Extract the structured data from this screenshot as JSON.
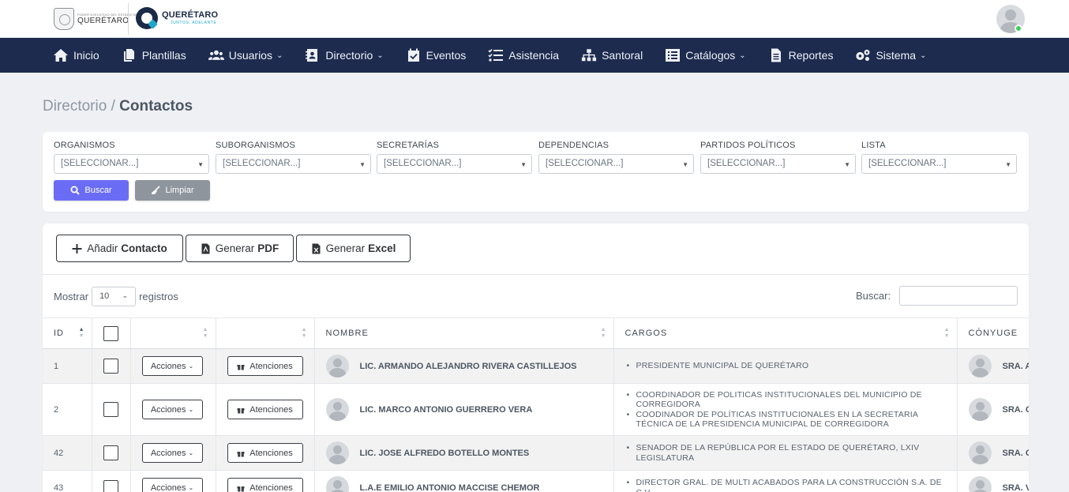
{
  "header": {
    "logo1_small": "PODER EJECUTIVO DEL ESTADO DE",
    "logo1_big": "QUERÉTARO",
    "logo2_title": "QUERÉTARO",
    "logo2_tag": "JUNTOS, ADELANTE"
  },
  "nav": [
    {
      "label": "Inicio",
      "icon": "home-icon",
      "dropdown": false
    },
    {
      "label": "Plantillas",
      "icon": "copy-icon",
      "dropdown": false
    },
    {
      "label": "Usuarios",
      "icon": "users-icon",
      "dropdown": true
    },
    {
      "label": "Directorio",
      "icon": "address-book-icon",
      "dropdown": true
    },
    {
      "label": "Eventos",
      "icon": "calendar-check-icon",
      "dropdown": false
    },
    {
      "label": "Asistencia",
      "icon": "checklist-icon",
      "dropdown": false
    },
    {
      "label": "Santoral",
      "icon": "sitemap-icon",
      "dropdown": false
    },
    {
      "label": "Catálogos",
      "icon": "list-alt-icon",
      "dropdown": true
    },
    {
      "label": "Reportes",
      "icon": "file-text-icon",
      "dropdown": false
    },
    {
      "label": "Sistema",
      "icon": "gears-icon",
      "dropdown": true
    }
  ],
  "breadcrumb": {
    "parent": "Directorio",
    "separator": " / ",
    "current": "Contactos"
  },
  "filters": [
    {
      "label": "ORGANISMOS",
      "value": "[SELECCIONAR...]"
    },
    {
      "label": "SUBORGANISMOS",
      "value": "[SELECCIONAR...]"
    },
    {
      "label": "SECRETARÍAS",
      "value": "[SELECCIONAR...]"
    },
    {
      "label": "DEPENDENCIAS",
      "value": "[SELECCIONAR...]"
    },
    {
      "label": "PARTIDOS POLÍTICOS",
      "value": "[SELECCIONAR...]"
    },
    {
      "label": "LISTA",
      "value": "[SELECCIONAR...]"
    }
  ],
  "filter_buttons": {
    "search": "Buscar",
    "clear": "Limpiar",
    "search_color": "#6a6cf5",
    "clear_color": "#8e959d"
  },
  "toolbar": {
    "add_prefix": "Añadir",
    "add_bold": "Contacto",
    "pdf_prefix": "Generar",
    "pdf_bold": "PDF",
    "excel_prefix": "Generar",
    "excel_bold": "Excel"
  },
  "table_controls": {
    "show_label": "Mostrar",
    "page_size": "10",
    "records_label": "registros",
    "search_label": "Buscar:",
    "search_value": ""
  },
  "columns": {
    "id": "ID",
    "nombre": "NOMBRE",
    "cargos": "CARGOS",
    "conyuge": "CÓNYUGE"
  },
  "row_buttons": {
    "actions": "Acciones",
    "attentions": "Atenciones"
  },
  "rows": [
    {
      "id": "1",
      "nombre": "LIC. ARMANDO ALEJANDRO RIVERA CASTILLEJOS",
      "cargos": [
        "PRESIDENTE MUNICIPAL DE QUERÉTARO"
      ],
      "conyuge": "SRA. A"
    },
    {
      "id": "2",
      "nombre": "LIC. MARCO ANTONIO GUERRERO VERA",
      "cargos": [
        "COORDINADOR DE POLITICAS INSTITUCIONALES DEL MUNICIPIO DE CORREGIDORA",
        "COODINADOR DE POLÍTICAS INSTITUCIONALES EN LA SECRETARIA TÉCNICA DE LA PRESIDENCIA MUNICIPAL DE CORREGIDORA"
      ],
      "conyuge": "SRA. G"
    },
    {
      "id": "42",
      "nombre": "LIC. JOSE ALFREDO BOTELLO MONTES",
      "cargos": [
        "SENADOR DE LA REPÚBLICA POR EL ESTADO DE QUERÉTARO, LXIV LEGISLATURA"
      ],
      "conyuge": "SRA. C"
    },
    {
      "id": "43",
      "nombre": "L.A.E EMILIO ANTONIO MACCISE CHEMOR",
      "cargos": [
        "DIRECTOR GRAL. DE MULTI ACABADOS PARA LA CONSTRUCCIÓN S.A. DE C.V."
      ],
      "conyuge": "SRA. V"
    }
  ],
  "colors": {
    "navbar": "#1d2b4f",
    "background": "#eef0f4",
    "online": "#3ecf5a"
  }
}
